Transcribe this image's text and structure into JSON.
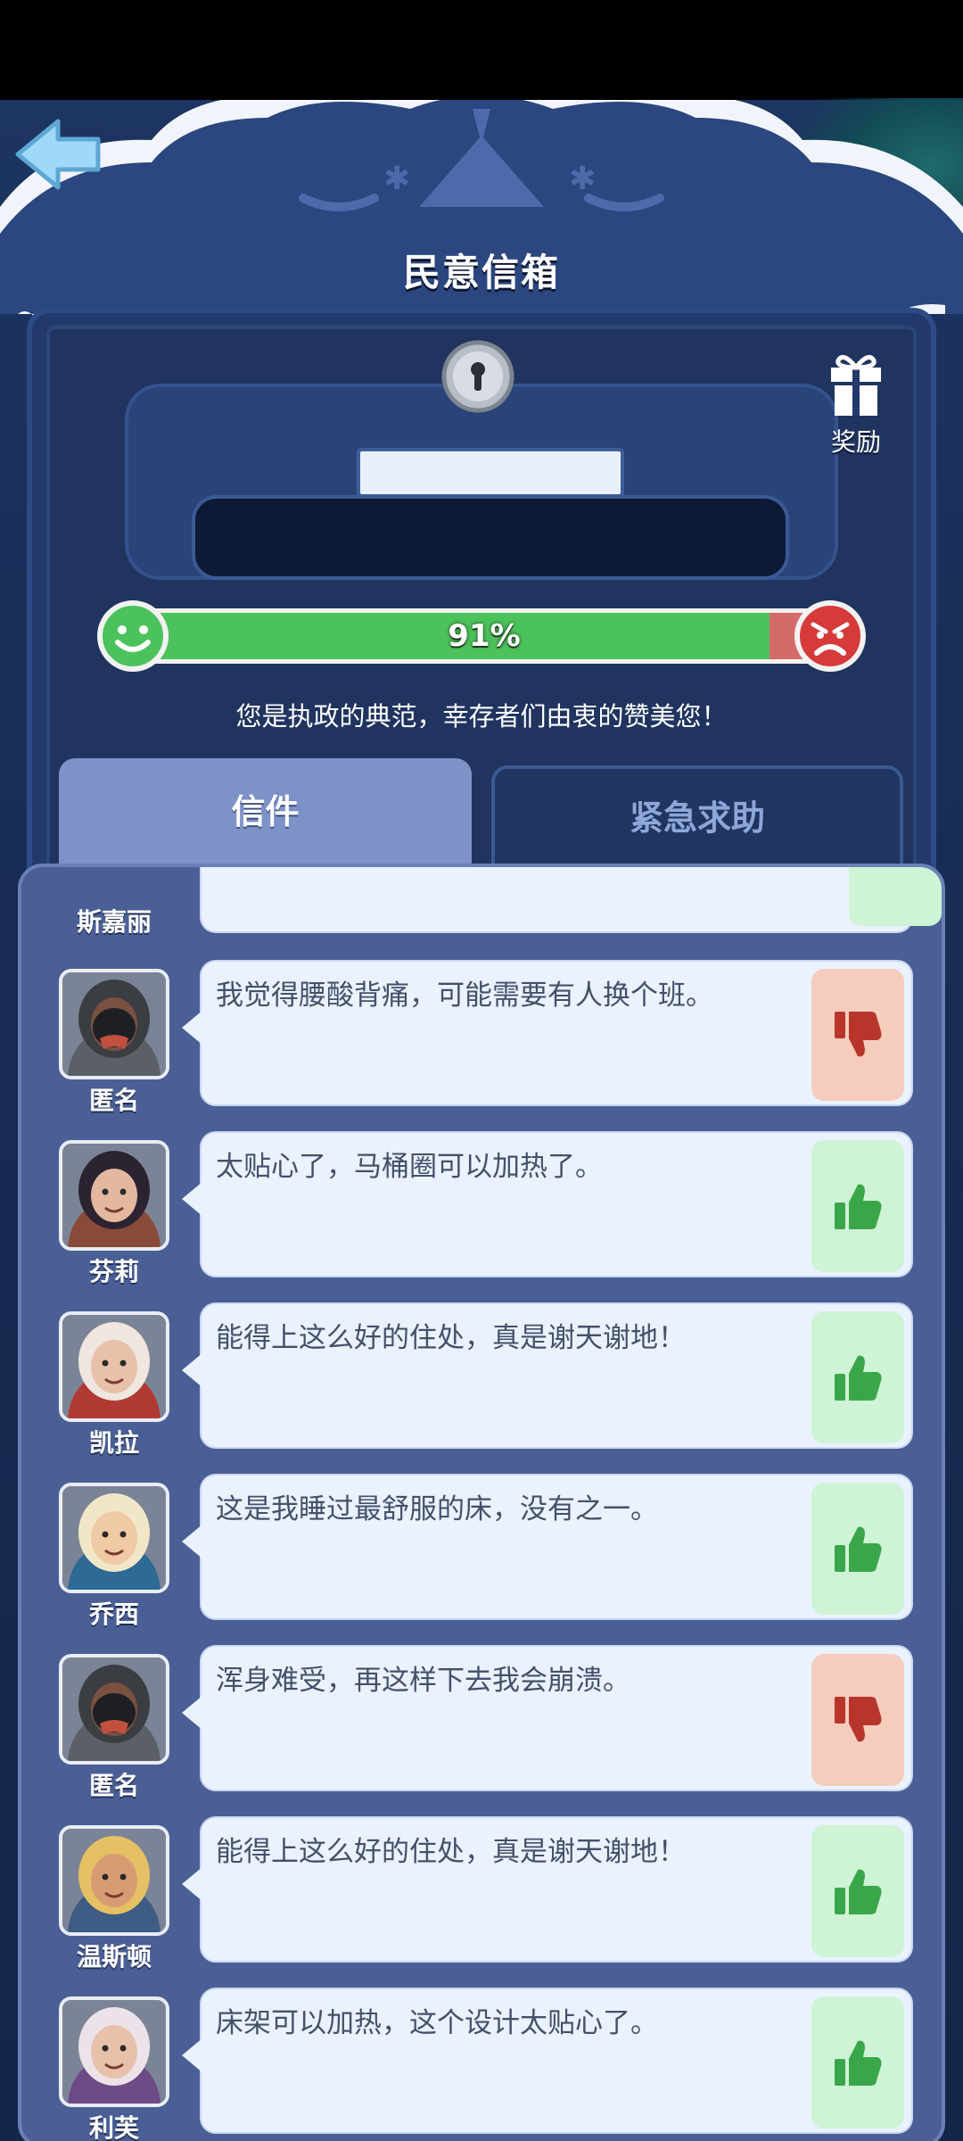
{
  "header": {
    "title": "民意信箱",
    "reward_label": "奖励"
  },
  "approval": {
    "percent_label": "91%",
    "value": 0.91,
    "caption": "您是执政的典范，幸存者们由衷的赞美您！"
  },
  "tabs": [
    {
      "label": "信件",
      "active": true
    },
    {
      "label": "紧急求助",
      "active": false
    }
  ],
  "partial_letter": {
    "name": "斯嘉丽",
    "vote": "up"
  },
  "letters": [
    {
      "name": "匿名",
      "text": "我觉得腰酸背痛，可能需要有人换个班。",
      "vote": "down",
      "avatar": "hooded-anonymous"
    },
    {
      "name": "芬莉",
      "text": "太贴心了，马桶圈可以加热了。",
      "vote": "up",
      "avatar": "woman-dark-hair"
    },
    {
      "name": "凯拉",
      "text": "能得上这么好的住处，真是谢天谢地！",
      "vote": "up",
      "avatar": "old-woman-red-hood"
    },
    {
      "name": "乔西",
      "text": "这是我睡过最舒服的床，没有之一。",
      "vote": "up",
      "avatar": "blonde-boy"
    },
    {
      "name": "匿名",
      "text": "浑身难受，再这样下去我会崩溃。",
      "vote": "down",
      "avatar": "hooded-anonymous"
    },
    {
      "name": "温斯顿",
      "text": "能得上这么好的住处，真是谢天谢地！",
      "vote": "up",
      "avatar": "smiling-man"
    },
    {
      "name": "利芙",
      "text": "床架可以加热，这个设计太贴心了。",
      "vote": "up",
      "avatar": "old-woman-purple-hood"
    }
  ],
  "colors": {
    "approve": "#4cc25c",
    "disapprove": "#d56a6a",
    "accent_tab": "#7d93c8"
  }
}
